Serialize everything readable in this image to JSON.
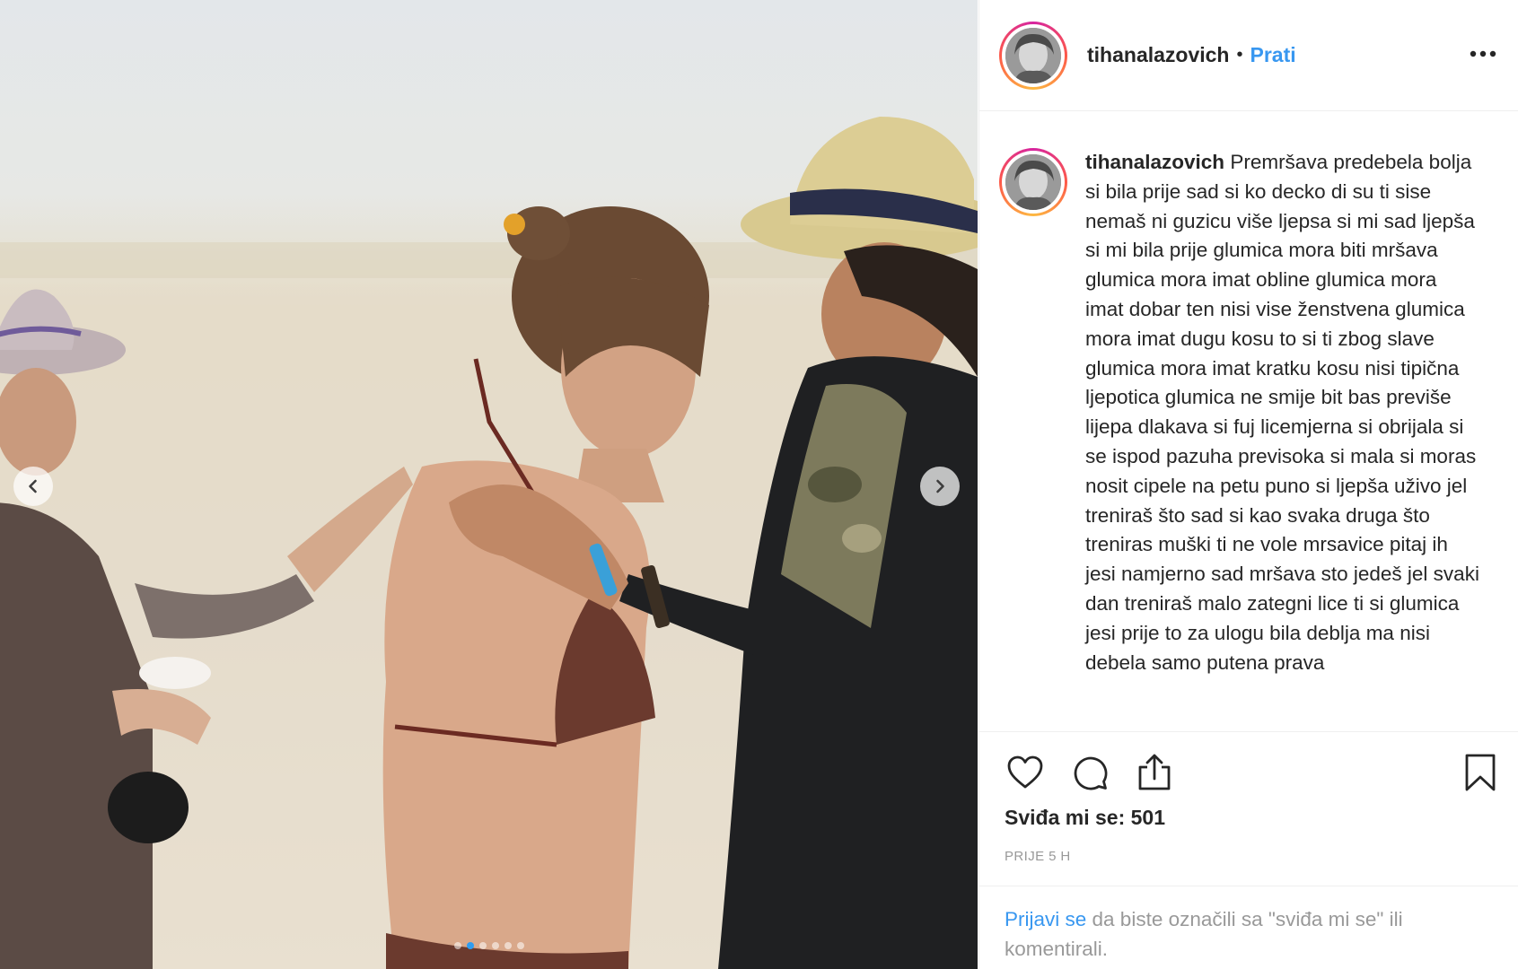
{
  "post": {
    "username": "tihanalazovich",
    "separator": "•",
    "follow_label": "Prati",
    "caption_user": "tihanalazovich",
    "caption_text": "Premršava predebela bolja si bila prije sad si ko decko di su ti sise nemaš ni guzicu više ljepsa si mi sad ljepša si mi bila prije glumica mora biti mršava glumica mora imat obline glumica mora imat dobar ten nisi vise ženstvena glumica mora imat dugu kosu to si ti zbog slave glumica mora imat kratku kosu nisi tipična ljepotica glumica ne smije bit bas previše lijepa dlakava si fuj licemjerna si obrijala si se ispod pazuha previsoka si mala si moras nosit cipele na petu puno si ljepša uživo jel treniraš što sad si kao svaka druga što treniras muški ti ne vole mrsavice pitaj ih jesi namjerno sad mršava sto jedeš jel svaki dan treniraš malo zategni lice ti si glumica jesi prije to za ulogu bila deblja ma nisi debela samo putena prava",
    "likes_label": "Sviđa mi se: 501",
    "timestamp": "PRIJE 5 H",
    "login_link": "Prijavi se",
    "login_text": " da biste označili sa \"sviđa mi se\" ili komentirali."
  },
  "carousel": {
    "slide_count": 6,
    "active_index": 1
  },
  "icons": {
    "more": "more-options-icon",
    "like": "heart-icon",
    "comment": "comment-bubble-icon",
    "share": "share-icon",
    "save": "bookmark-icon",
    "prev": "chevron-left-icon",
    "next": "chevron-right-icon"
  },
  "colors": {
    "link": "#3897f0",
    "text": "#262626",
    "muted": "#999999",
    "dot_active": "#2f9cf0"
  }
}
